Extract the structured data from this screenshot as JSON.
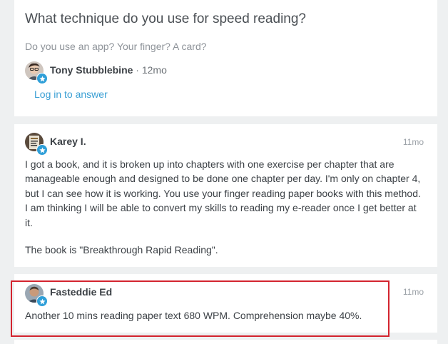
{
  "question": {
    "title": "What technique do you use for speed reading?",
    "subtitle": "Do you use an app? Your finger? A card?",
    "author": "Tony Stubblebine",
    "separator": " · ",
    "age": "12mo",
    "login_label": "Log in to answer"
  },
  "answers": [
    {
      "author": "Karey I.",
      "time": "11mo",
      "paragraphs": [
        "I got a book, and it is broken up into chapters with one exercise per chapter that are manageable enough and designed to be done one chapter per day. I'm only on chapter 4, but I can see how it is working. You use your finger reading paper books with this method. I am thinking I will be able to convert my skills to reading my e-reader once I get better at it.",
        "The book is \"Breakthrough Rapid Reading\"."
      ]
    },
    {
      "author": "Fasteddie Ed",
      "time": "11mo",
      "paragraphs": [
        "Another 10 mins reading paper text 680 WPM. Comprehension maybe 40%."
      ]
    }
  ],
  "colors": {
    "accent": "#3a9fd4",
    "badge": "#2f9fd8",
    "highlight": "#d3242f",
    "background": "#eef0f1"
  }
}
